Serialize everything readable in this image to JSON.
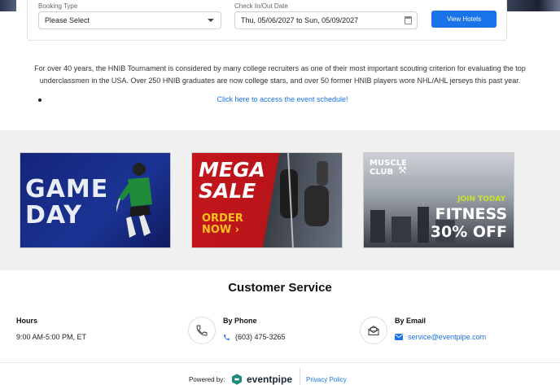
{
  "booking": {
    "booking_type_label": "Booking Type",
    "booking_type_value": "Please Select",
    "dates_label": "Check In/Out Date",
    "dates_value": "Thu, 05/06/2027 to Sun, 05/09/2027",
    "view_hotels_label": "View Hotels"
  },
  "intro": {
    "text": "For over 40 years, the HNIB Tournament is considered by many college recruiters as one of their most important scouting criterion for evaluating the top underclassmen in the USA. Over 250 HNIB graduates are now college stars, and over 50 former HNIB players wore NHL/AHL jerseys this past year.",
    "schedule_link": "Click here to access the event schedule!"
  },
  "promos": [
    {
      "line1": "GAME",
      "line2": "DAY"
    },
    {
      "line1": "MEGA",
      "line2": "SALE",
      "cta1": "ORDER",
      "cta2": "NOW ›"
    },
    {
      "brand1": "MUSCLE",
      "brand2": "CLUB",
      "cta": "JOIN TODAY",
      "line1": "FITNESS",
      "line2": "30% OFF"
    }
  ],
  "customer_service": {
    "title": "Customer Service",
    "hours_label": "Hours",
    "hours_value": "9:00 AM-5:00 PM, ET",
    "phone_label": "By Phone",
    "phone_value": "(603) 475-3265",
    "email_label": "By Email",
    "email_value": "service@eventpipe.com"
  },
  "footer": {
    "powered_by": "Powered by:",
    "brand": "eventpipe",
    "privacy": "Privacy Policy"
  },
  "colors": {
    "accent": "#1a73e8",
    "band": "#f0f0f0"
  }
}
